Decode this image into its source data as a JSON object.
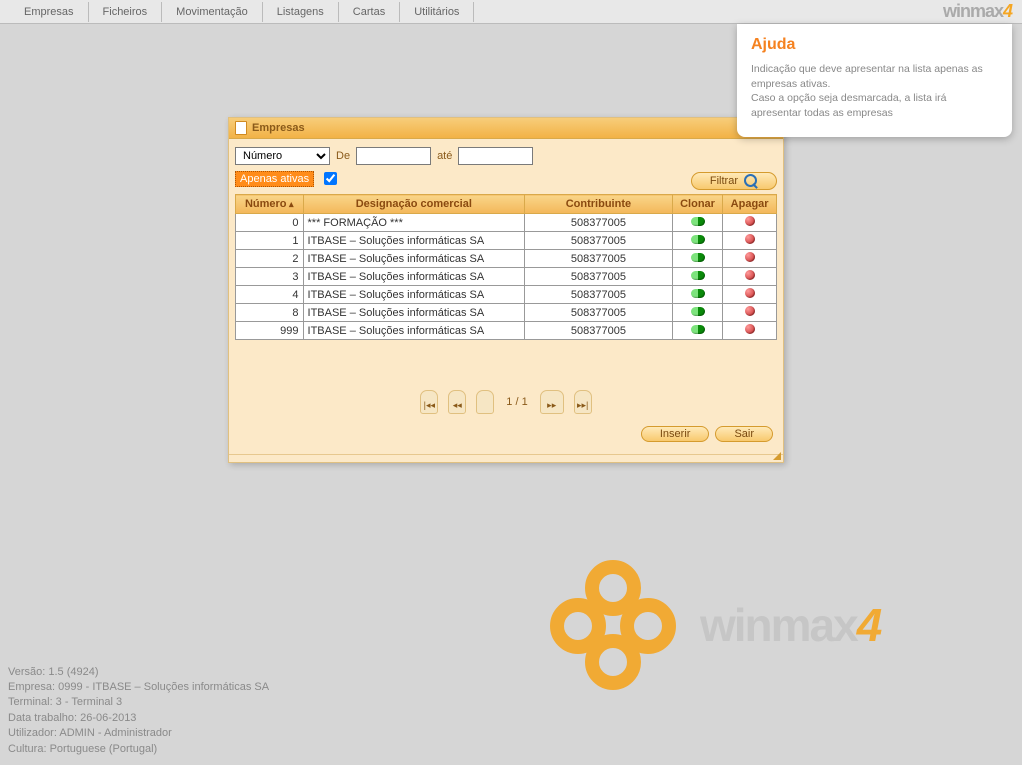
{
  "brand": {
    "name": "winmax",
    "suffix": "4"
  },
  "menu": [
    "Empresas",
    "Ficheiros",
    "Movimentação",
    "Listagens",
    "Cartas",
    "Utilitários"
  ],
  "help": {
    "title": "Ajuda",
    "body": "Indicação que deve apresentar na lista apenas as empresas ativas.\nCaso a opção seja desmarcada, a lista irá apresentar todas as empresas"
  },
  "window": {
    "title": "Empresas",
    "filter_field": "Número",
    "de": "De",
    "ate": "até",
    "from_value": "",
    "to_value": "",
    "apenas_label": "Apenas ativas",
    "apenas_checked": true,
    "filtrar": "Filtrar",
    "columns": {
      "numero": "Número",
      "desig": "Designação comercial",
      "contrib": "Contribuinte",
      "clonar": "Clonar",
      "apagar": "Apagar"
    },
    "rows": [
      {
        "numero": "0",
        "desig": "*** FORMAÇÃO ***",
        "contrib": "508377005"
      },
      {
        "numero": "1",
        "desig": "ITBASE – Soluções informáticas SA",
        "contrib": "508377005"
      },
      {
        "numero": "2",
        "desig": "ITBASE – Soluções informáticas SA",
        "contrib": "508377005"
      },
      {
        "numero": "3",
        "desig": "ITBASE – Soluções informáticas SA",
        "contrib": "508377005"
      },
      {
        "numero": "4",
        "desig": "ITBASE – Soluções informáticas SA",
        "contrib": "508377005"
      },
      {
        "numero": "8",
        "desig": "ITBASE – Soluções informáticas SA",
        "contrib": "508377005"
      },
      {
        "numero": "999",
        "desig": "ITBASE – Soluções informáticas SA",
        "contrib": "508377005"
      }
    ],
    "page": "1 / 1",
    "inserir": "Inserir",
    "sair": "Sair"
  },
  "status": {
    "versao": "Versão: 1.5 (4924)",
    "empresa": "Empresa: 0999 - ITBASE – Soluções informáticas SA",
    "terminal": "Terminal: 3 - Terminal 3",
    "data": "Data trabalho: 26-06-2013",
    "utilizador": "Utilizador: ADMIN - Administrador",
    "cultura": "Cultura: Portuguese (Portugal)"
  }
}
